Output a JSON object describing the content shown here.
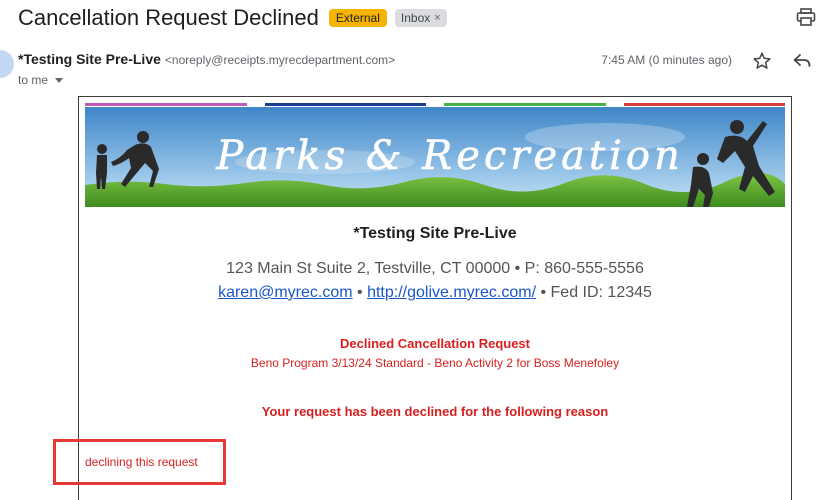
{
  "email": {
    "subject": "Cancellation Request Declined",
    "labels": {
      "external": "External",
      "inbox": "Inbox",
      "remove_glyph": "×"
    },
    "sender_name": "*Testing Site Pre-Live",
    "sender_email": "<noreply@receipts.myrecdepartment.com>",
    "recipient": "to me",
    "time": "7:45 AM (0 minutes ago)",
    "icons": {
      "print": "print-icon",
      "star": "star-icon",
      "reply": "reply-icon",
      "caret": "chevron-down-icon"
    }
  },
  "body": {
    "banner_text": "Parks & Recreation",
    "stripe_colors": [
      "#c05ab8",
      "#1c3f94",
      "#44b44a",
      "#d63c3c"
    ],
    "organization": "*Testing Site Pre-Live",
    "address": "123 Main St Suite 2, Testville, CT 00000 • P: 860-555-5556",
    "email_link": "karen@myrec.com",
    "separator": " • ",
    "website_link": "http://golive.myrec.com/",
    "fed_id": " • Fed ID: 12345",
    "declined_title": "Declined Cancellation Request",
    "declined_program": "Beno Program 3/13/24 Standard - Beno Activity 2 for Boss Menefoley",
    "reason_heading": "Your request has been declined for the following reason",
    "reason": "declining this request"
  },
  "colors": {
    "alert_red": "#d81f1f",
    "highlight_box": "#e53935",
    "link_blue": "#1a55c9",
    "external_badge": "#f4b400"
  }
}
